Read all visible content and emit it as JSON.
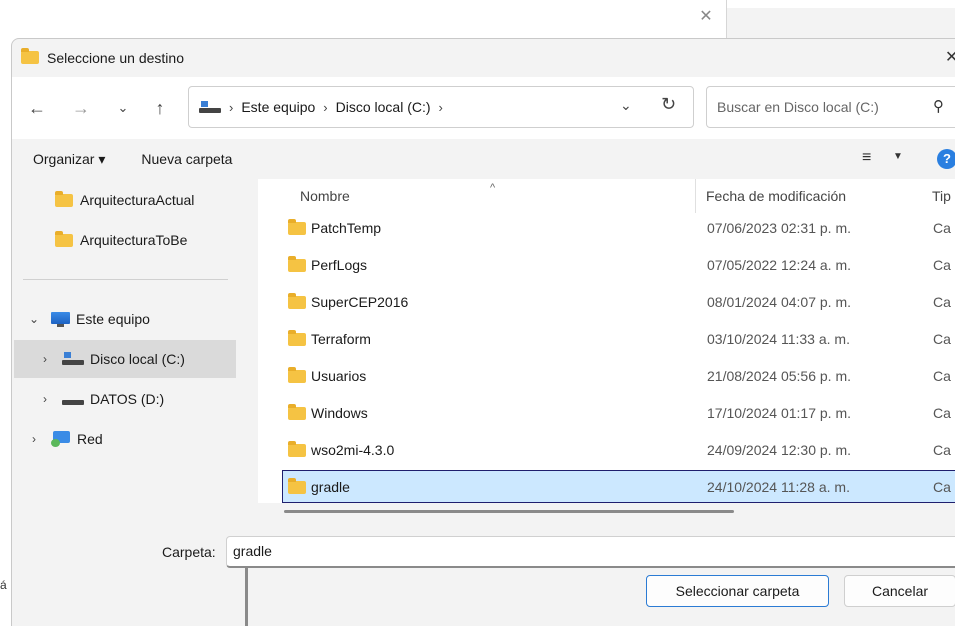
{
  "dialog": {
    "title": "Seleccione un destino"
  },
  "address": {
    "crumbs": [
      "Este equipo",
      "Disco local (C:)"
    ]
  },
  "search": {
    "placeholder": "Buscar en Disco local (C:)"
  },
  "toolbar": {
    "organize": "Organizar ▾",
    "new_folder": "Nueva carpeta"
  },
  "navpane": {
    "folders": [
      "ArquitecturaActual",
      "ArquitecturaToBe"
    ],
    "this_pc": "Este equipo",
    "drive_c": "Disco local (C:)",
    "drive_d": "DATOS (D:)",
    "network": "Red"
  },
  "list": {
    "headers": {
      "name": "Nombre",
      "date": "Fecha de modificación",
      "type": "Tip"
    },
    "rows": [
      {
        "name": "PatchTemp",
        "date": "07/06/2023 02:31 p. m.",
        "type": "Ca"
      },
      {
        "name": "PerfLogs",
        "date": "07/05/2022 12:24 a. m.",
        "type": "Ca"
      },
      {
        "name": "SuperCEP2016",
        "date": "08/01/2024 04:07 p. m.",
        "type": "Ca"
      },
      {
        "name": "Terraform",
        "date": "03/10/2024 11:33 a. m.",
        "type": "Ca"
      },
      {
        "name": "Usuarios",
        "date": "21/08/2024 05:56 p. m.",
        "type": "Ca"
      },
      {
        "name": "Windows",
        "date": "17/10/2024 01:17 p. m.",
        "type": "Ca"
      },
      {
        "name": "wso2mi-4.3.0",
        "date": "24/09/2024 12:30 p. m.",
        "type": "Ca"
      },
      {
        "name": "gradle",
        "date": "24/10/2024 11:28 a. m.",
        "type": "Ca"
      }
    ]
  },
  "bottom": {
    "folder_label": "Carpeta:",
    "folder_value": "gradle",
    "select_button": "Seleccionar carpeta",
    "cancel_button": "Cancelar"
  },
  "colors": {
    "selection": "#cce8ff",
    "accent": "#2b7bd4",
    "folder": "#f5c343"
  }
}
